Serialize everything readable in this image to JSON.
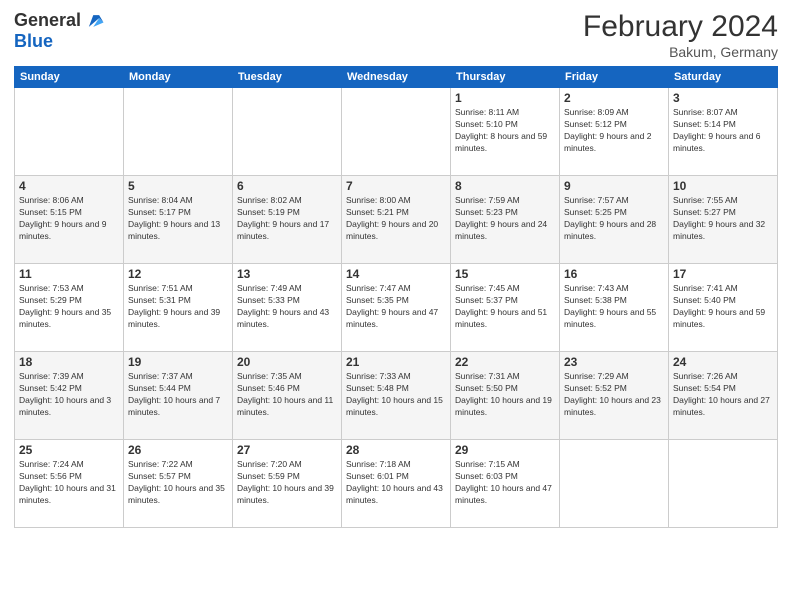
{
  "header": {
    "logo_line1": "General",
    "logo_line2": "Blue",
    "title": "February 2024",
    "subtitle": "Bakum, Germany"
  },
  "weekdays": [
    "Sunday",
    "Monday",
    "Tuesday",
    "Wednesday",
    "Thursday",
    "Friday",
    "Saturday"
  ],
  "weeks": [
    [
      {
        "day": "",
        "info": ""
      },
      {
        "day": "",
        "info": ""
      },
      {
        "day": "",
        "info": ""
      },
      {
        "day": "",
        "info": ""
      },
      {
        "day": "1",
        "info": "Sunrise: 8:11 AM\nSunset: 5:10 PM\nDaylight: 8 hours and 59 minutes."
      },
      {
        "day": "2",
        "info": "Sunrise: 8:09 AM\nSunset: 5:12 PM\nDaylight: 9 hours and 2 minutes."
      },
      {
        "day": "3",
        "info": "Sunrise: 8:07 AM\nSunset: 5:14 PM\nDaylight: 9 hours and 6 minutes."
      }
    ],
    [
      {
        "day": "4",
        "info": "Sunrise: 8:06 AM\nSunset: 5:15 PM\nDaylight: 9 hours and 9 minutes."
      },
      {
        "day": "5",
        "info": "Sunrise: 8:04 AM\nSunset: 5:17 PM\nDaylight: 9 hours and 13 minutes."
      },
      {
        "day": "6",
        "info": "Sunrise: 8:02 AM\nSunset: 5:19 PM\nDaylight: 9 hours and 17 minutes."
      },
      {
        "day": "7",
        "info": "Sunrise: 8:00 AM\nSunset: 5:21 PM\nDaylight: 9 hours and 20 minutes."
      },
      {
        "day": "8",
        "info": "Sunrise: 7:59 AM\nSunset: 5:23 PM\nDaylight: 9 hours and 24 minutes."
      },
      {
        "day": "9",
        "info": "Sunrise: 7:57 AM\nSunset: 5:25 PM\nDaylight: 9 hours and 28 minutes."
      },
      {
        "day": "10",
        "info": "Sunrise: 7:55 AM\nSunset: 5:27 PM\nDaylight: 9 hours and 32 minutes."
      }
    ],
    [
      {
        "day": "11",
        "info": "Sunrise: 7:53 AM\nSunset: 5:29 PM\nDaylight: 9 hours and 35 minutes."
      },
      {
        "day": "12",
        "info": "Sunrise: 7:51 AM\nSunset: 5:31 PM\nDaylight: 9 hours and 39 minutes."
      },
      {
        "day": "13",
        "info": "Sunrise: 7:49 AM\nSunset: 5:33 PM\nDaylight: 9 hours and 43 minutes."
      },
      {
        "day": "14",
        "info": "Sunrise: 7:47 AM\nSunset: 5:35 PM\nDaylight: 9 hours and 47 minutes."
      },
      {
        "day": "15",
        "info": "Sunrise: 7:45 AM\nSunset: 5:37 PM\nDaylight: 9 hours and 51 minutes."
      },
      {
        "day": "16",
        "info": "Sunrise: 7:43 AM\nSunset: 5:38 PM\nDaylight: 9 hours and 55 minutes."
      },
      {
        "day": "17",
        "info": "Sunrise: 7:41 AM\nSunset: 5:40 PM\nDaylight: 9 hours and 59 minutes."
      }
    ],
    [
      {
        "day": "18",
        "info": "Sunrise: 7:39 AM\nSunset: 5:42 PM\nDaylight: 10 hours and 3 minutes."
      },
      {
        "day": "19",
        "info": "Sunrise: 7:37 AM\nSunset: 5:44 PM\nDaylight: 10 hours and 7 minutes."
      },
      {
        "day": "20",
        "info": "Sunrise: 7:35 AM\nSunset: 5:46 PM\nDaylight: 10 hours and 11 minutes."
      },
      {
        "day": "21",
        "info": "Sunrise: 7:33 AM\nSunset: 5:48 PM\nDaylight: 10 hours and 15 minutes."
      },
      {
        "day": "22",
        "info": "Sunrise: 7:31 AM\nSunset: 5:50 PM\nDaylight: 10 hours and 19 minutes."
      },
      {
        "day": "23",
        "info": "Sunrise: 7:29 AM\nSunset: 5:52 PM\nDaylight: 10 hours and 23 minutes."
      },
      {
        "day": "24",
        "info": "Sunrise: 7:26 AM\nSunset: 5:54 PM\nDaylight: 10 hours and 27 minutes."
      }
    ],
    [
      {
        "day": "25",
        "info": "Sunrise: 7:24 AM\nSunset: 5:56 PM\nDaylight: 10 hours and 31 minutes."
      },
      {
        "day": "26",
        "info": "Sunrise: 7:22 AM\nSunset: 5:57 PM\nDaylight: 10 hours and 35 minutes."
      },
      {
        "day": "27",
        "info": "Sunrise: 7:20 AM\nSunset: 5:59 PM\nDaylight: 10 hours and 39 minutes."
      },
      {
        "day": "28",
        "info": "Sunrise: 7:18 AM\nSunset: 6:01 PM\nDaylight: 10 hours and 43 minutes."
      },
      {
        "day": "29",
        "info": "Sunrise: 7:15 AM\nSunset: 6:03 PM\nDaylight: 10 hours and 47 minutes."
      },
      {
        "day": "",
        "info": ""
      },
      {
        "day": "",
        "info": ""
      }
    ]
  ]
}
